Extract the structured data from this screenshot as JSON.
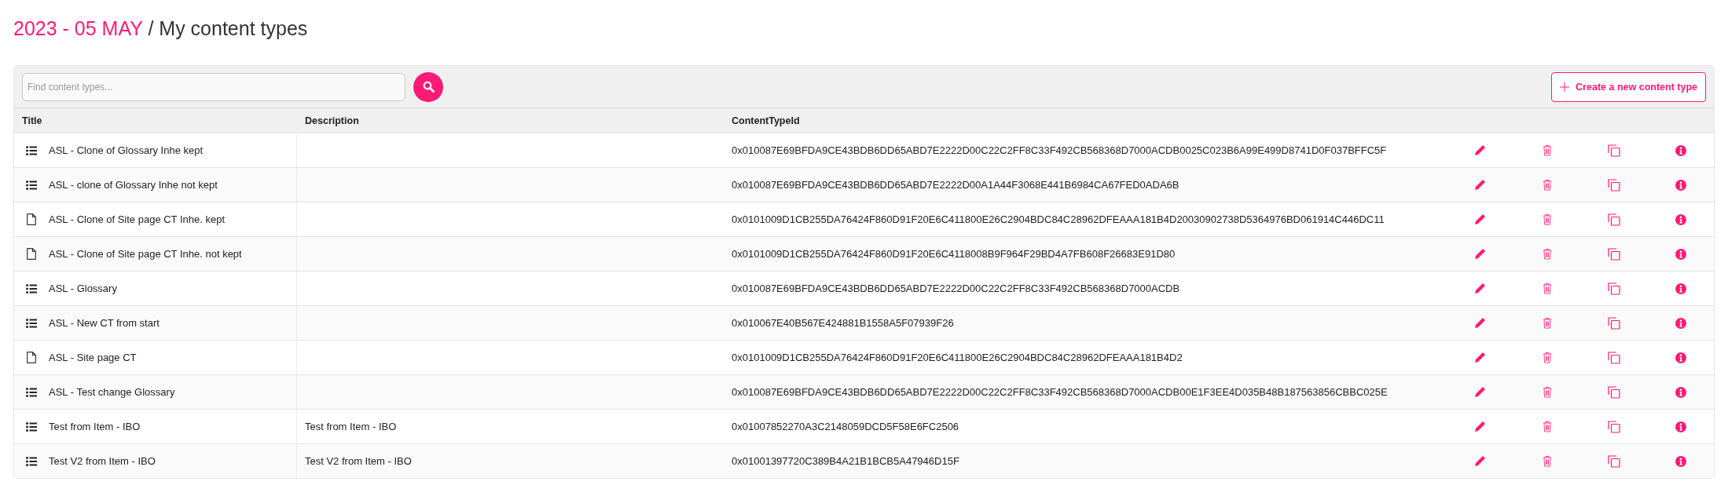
{
  "heading": {
    "period": "2023 - 05 MAY",
    "separator": "/",
    "page": "My content types"
  },
  "toolbar": {
    "search": {
      "placeholder": "Find content types..."
    },
    "create_button": "Create a new content type"
  },
  "table": {
    "columns": [
      "Title",
      "Description",
      "ContentTypeId"
    ],
    "rows": [
      {
        "kind": "list",
        "title": "ASL - Clone of Glossary Inhe kept",
        "id": "0x010087E69BFDA9CE43BDB6DD65ABD7E2222D00C22C2FF8C33F492CB568368D7000ACDB0025C023B6A99E499D8741D0F037BFFC5F"
      },
      {
        "kind": "list",
        "title": "ASL - clone of Glossary Inhe not kept",
        "id": "0x010087E69BFDA9CE43BDB6DD65ABD7E2222D00A1A44F3068E441B6984CA67FED0ADA6B"
      },
      {
        "kind": "page",
        "title": "ASL - Clone of Site page CT Inhe. kept",
        "id": "0x0101009D1CB255DA76424F860D91F20E6C411800E26C2904BDC84C28962DFEAAA181B4D20030902738D5364976BD061914C446DC11"
      },
      {
        "kind": "page",
        "title": "ASL - Clone of Site page CT Inhe. not kept",
        "id": "0x0101009D1CB255DA76424F860D91F20E6C4118008B9F964F29BD4A7FB608F26683E91D80"
      },
      {
        "kind": "list",
        "title": "ASL - Glossary",
        "id": "0x010087E69BFDA9CE43BDB6DD65ABD7E2222D00C22C2FF8C33F492CB568368D7000ACDB"
      },
      {
        "kind": "list",
        "title": "ASL - New CT from start",
        "id": "0x010067E40B567E424881B1558A5F07939F26"
      },
      {
        "kind": "page",
        "title": "ASL - Site page CT",
        "id": "0x0101009D1CB255DA76424F860D91F20E6C411800E26C2904BDC84C28962DFEAAA181B4D2"
      },
      {
        "kind": "list",
        "title": "ASL - Test change Glossary",
        "id": "0x010087E69BFDA9CE43BDB6DD65ABD7E2222D00C22C2FF8C33F492CB568368D7000ACDB00E1F3EE4D035B48B187563856CBBC025E"
      },
      {
        "kind": "list",
        "title": "Test from Item - IBO",
        "description": "Test from Item - IBO",
        "id": "0x01007852270A3C2148059DCD5F58E6FC2506"
      },
      {
        "kind": "list",
        "title": "Test V2 from Item - IBO",
        "description": "Test V2 from Item - IBO",
        "id": "0x01001397720C389B4A21B1BCB5A47946D15F"
      }
    ]
  }
}
